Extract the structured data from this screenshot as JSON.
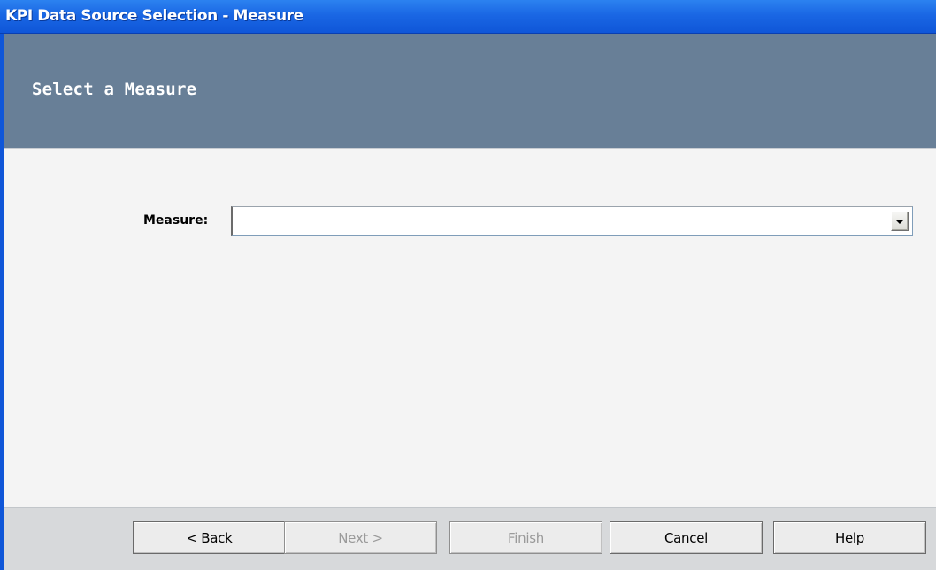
{
  "window": {
    "title": "KPI Data Source Selection - Measure"
  },
  "header": {
    "step_title": "Select a Measure"
  },
  "form": {
    "measure_label": "Measure:",
    "measure_value": ""
  },
  "footer": {
    "back_label": "< Back",
    "next_label": "Next >",
    "finish_label": "Finish",
    "cancel_label": "Cancel",
    "help_label": "Help"
  },
  "colors": {
    "titlebar": "#1a67e4",
    "header_panel": "#687f97",
    "content_bg": "#f4f4f4",
    "footer_bg": "#d7d9db"
  }
}
